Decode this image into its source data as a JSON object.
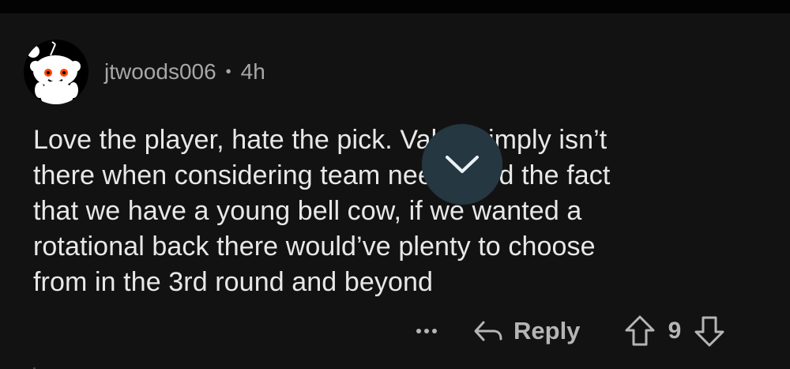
{
  "comment": {
    "author": "jtwoods006",
    "separator": "•",
    "age": "4h",
    "body_lines": [
      "Love the player, hate the pick. Value simply isn’t",
      "there when considering team needs and the fact",
      "that we have a young bell cow, if we wanted a",
      "rotational back there would’ve plenty to choose",
      "from in the 3rd round and beyond"
    ],
    "actions": {
      "more_icon": "more-horizontal-icon",
      "reply_label": "Reply",
      "reply_icon": "reply-arrow-icon",
      "upvote_icon": "upvote-arrow-icon",
      "score": "9",
      "downvote_icon": "downvote-arrow-icon"
    }
  },
  "overlay": {
    "scroll_button_icon": "chevron-down-icon",
    "scroll_button_color": "#253741"
  },
  "colors": {
    "background": "#121212",
    "topbar": "#030303",
    "body_text": "#e8e8e8",
    "meta_text": "#a7a7a7",
    "action_text": "#b5b5b5"
  }
}
